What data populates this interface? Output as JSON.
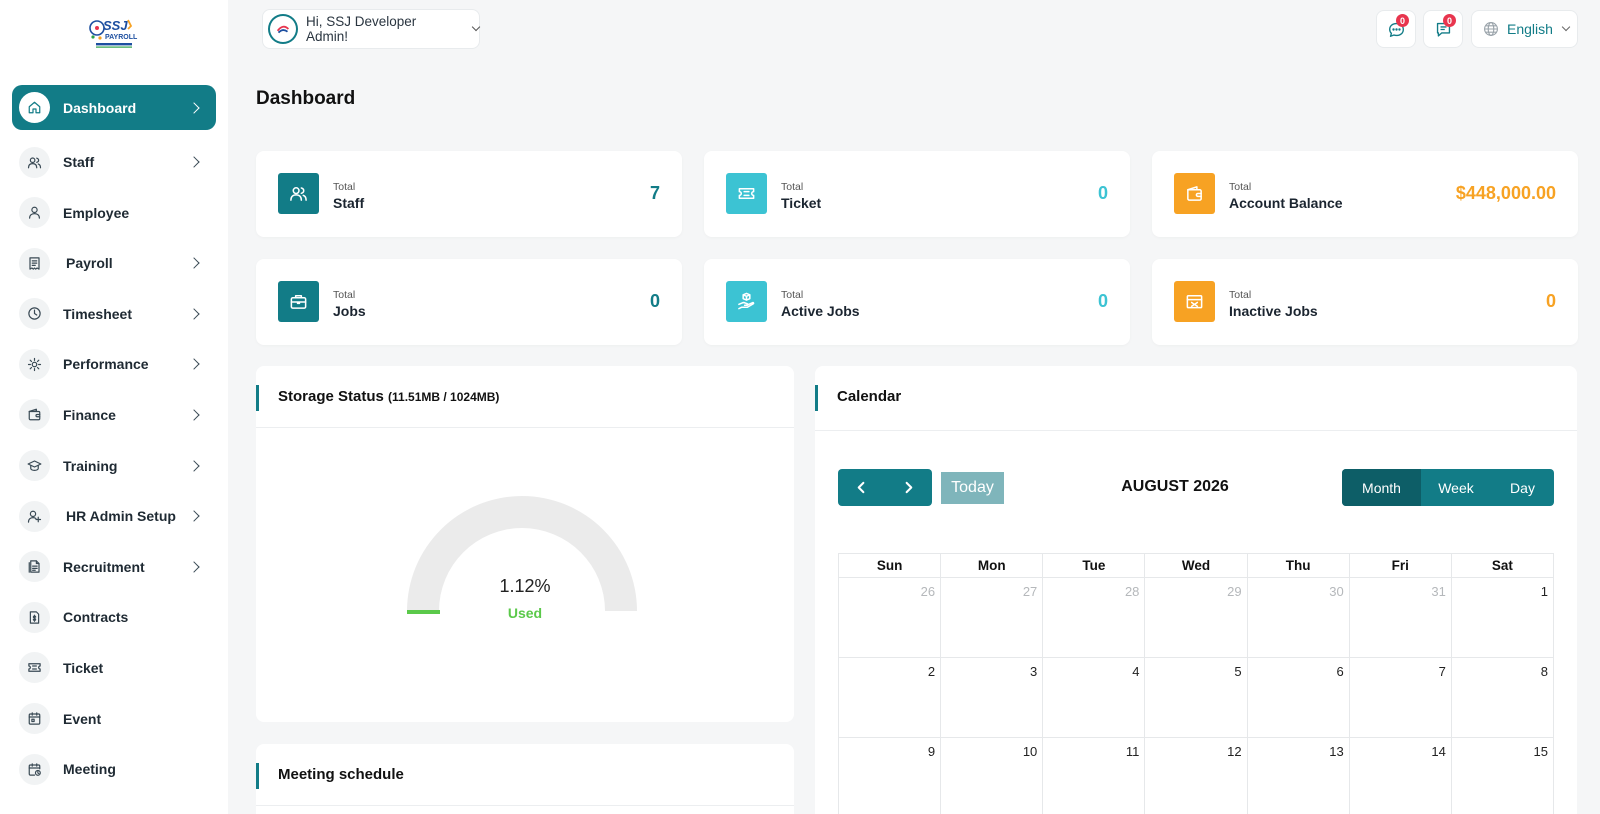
{
  "header": {
    "greeting": "Hi, SSJ Developer Admin!",
    "chat_badge": "0",
    "message_badge": "0",
    "language": "English"
  },
  "page_title": "Dashboard",
  "sidebar": {
    "items": [
      {
        "label": "Dashboard",
        "icon": "home-icon",
        "has_children": true,
        "active": true
      },
      {
        "label": "Staff",
        "icon": "users-icon",
        "has_children": true
      },
      {
        "label": "Employee",
        "icon": "user-icon",
        "has_children": false
      },
      {
        "label": "Payroll",
        "icon": "receipt-icon",
        "has_children": true
      },
      {
        "label": "Timesheet",
        "icon": "clock-icon",
        "has_children": true
      },
      {
        "label": "Performance",
        "icon": "target-icon",
        "has_children": true
      },
      {
        "label": "Finance",
        "icon": "wallet-icon",
        "has_children": true
      },
      {
        "label": "Training",
        "icon": "graduation-cap-icon",
        "has_children": true
      },
      {
        "label": "HR Admin Setup",
        "icon": "user-plus-icon",
        "has_children": true
      },
      {
        "label": "Recruitment",
        "icon": "document-icon",
        "has_children": true
      },
      {
        "label": "Contracts",
        "icon": "file-dollar-icon",
        "has_children": false
      },
      {
        "label": "Ticket",
        "icon": "ticket-icon",
        "has_children": false
      },
      {
        "label": "Event",
        "icon": "calendar-icon",
        "has_children": false
      },
      {
        "label": "Meeting",
        "icon": "calendar-clock-icon",
        "has_children": false
      }
    ]
  },
  "stats": [
    {
      "small": "Total",
      "label": "Staff",
      "value": "7",
      "color": "#127c87",
      "icon": "users-icon"
    },
    {
      "small": "Total",
      "label": "Ticket",
      "value": "0",
      "color": "#3cc3d3",
      "icon": "ticket-icon"
    },
    {
      "small": "Total",
      "label": "Account Balance",
      "value": "$448,000.00",
      "color": "#f7a223",
      "icon": "wallet-icon"
    },
    {
      "small": "Total",
      "label": "Jobs",
      "value": "0",
      "color": "#127c87",
      "icon": "briefcase-icon"
    },
    {
      "small": "Total",
      "label": "Active Jobs",
      "value": "0",
      "color": "#3cc3d3",
      "icon": "hand-box-icon"
    },
    {
      "small": "Total",
      "label": "Inactive Jobs",
      "value": "0",
      "color": "#f7a223",
      "icon": "box-x-icon"
    }
  ],
  "storage": {
    "title": "Storage Status",
    "detail": "(11.51MB / 1024MB)",
    "percent": 1.12,
    "percent_label": "1.12%",
    "used_label": "Used"
  },
  "meeting": {
    "title": "Meeting schedule"
  },
  "calendar": {
    "title": "Calendar",
    "today_label": "Today",
    "month_label": "AUGUST 2026",
    "views": [
      "Month",
      "Week",
      "Day"
    ],
    "active_view": "Month",
    "weekdays": [
      "Sun",
      "Mon",
      "Tue",
      "Wed",
      "Thu",
      "Fri",
      "Sat"
    ],
    "weeks": [
      [
        {
          "d": "26",
          "other": true
        },
        {
          "d": "27",
          "other": true
        },
        {
          "d": "28",
          "other": true
        },
        {
          "d": "29",
          "other": true
        },
        {
          "d": "30",
          "other": true
        },
        {
          "d": "31",
          "other": true
        },
        {
          "d": "1"
        }
      ],
      [
        {
          "d": "2"
        },
        {
          "d": "3"
        },
        {
          "d": "4"
        },
        {
          "d": "5"
        },
        {
          "d": "6"
        },
        {
          "d": "7"
        },
        {
          "d": "8"
        }
      ],
      [
        {
          "d": "9"
        },
        {
          "d": "10"
        },
        {
          "d": "11"
        },
        {
          "d": "12"
        },
        {
          "d": "13"
        },
        {
          "d": "14"
        },
        {
          "d": "15"
        }
      ]
    ]
  },
  "colors": {
    "accent": "#127c87",
    "cyan": "#3cc3d3",
    "orange": "#f7a223",
    "success": "#5bc94a",
    "badge": "#e8354e"
  }
}
